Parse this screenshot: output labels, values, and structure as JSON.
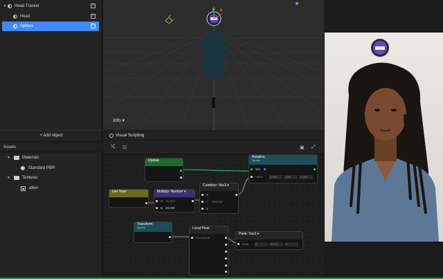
{
  "hierarchy": {
    "items": [
      {
        "label": "Head Tracker",
        "check": "✓"
      },
      {
        "label": "Head",
        "check": "✓"
      },
      {
        "label": "Sphere",
        "check": "✓"
      }
    ],
    "add_object": "+ Add object"
  },
  "assets": {
    "title": "Assets",
    "items": [
      {
        "label": "Materials"
      },
      {
        "label": "Standard PBR"
      },
      {
        "label": "Textures"
      },
      {
        "label": "alien"
      }
    ]
  },
  "viewport": {
    "info_label": "Info ▾"
  },
  "visual_scripting": {
    "title": "Visual Scripting",
    "nodes": {
      "update": {
        "title": "Update"
      },
      "get_time": {
        "title": "Get Time"
      },
      "multiply": {
        "title": "Multiply: Number ▾",
        "a_label": "A",
        "a_value": "31.833",
        "b_label": "B",
        "b_value": "50.000"
      },
      "combine": {
        "title": "Combine: Vec3 ▾",
        "x": "X",
        "y": "Y",
        "y_value": "1591.65",
        "z": "Z"
      },
      "rotation": {
        "title": "Rotation",
        "subtitle": "Sphere",
        "set_label": "Set",
        "value_label": "Value",
        "v1": "0.000",
        "v2": "1591",
        "v3": "0.000"
      },
      "transform": {
        "title": "Transform",
        "subtitle": "Sphere"
      },
      "local_pose": {
        "title": "Local Pose",
        "in_label": "Transform"
      },
      "peek": {
        "title": "Peek: Vec3 ▾",
        "data_label": "Data",
        "v1": "0",
        "v2": "90.00",
        "v3": "0"
      }
    }
  },
  "colors": {
    "accent": "#3d8bfd",
    "update_header": "#1f6b2e",
    "get_time_header": "#6b6a1c",
    "multiply_header": "#3a3270",
    "teal_header": "#1d4e59",
    "exec_line": "#2fd07a"
  }
}
